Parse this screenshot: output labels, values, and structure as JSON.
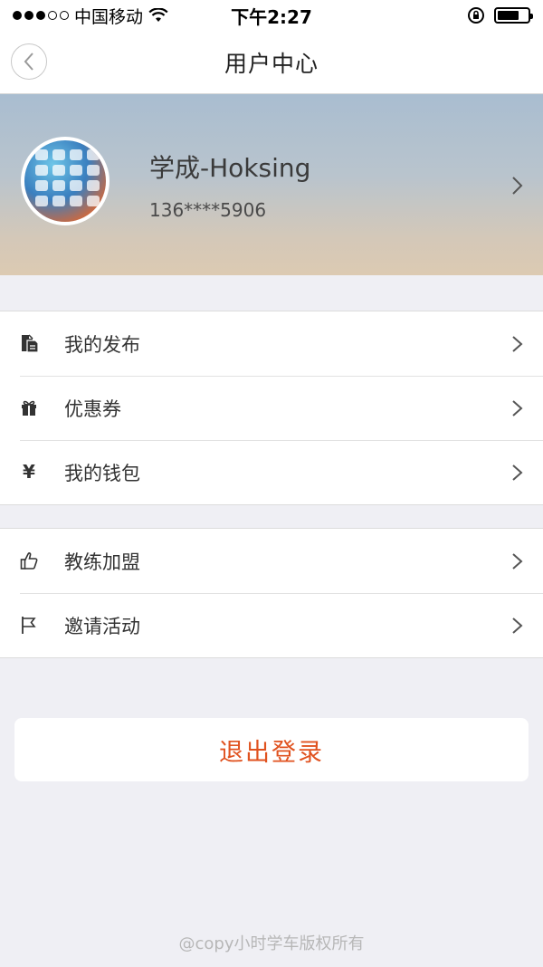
{
  "status_bar": {
    "carrier": "中国移动",
    "time": "下午2:27"
  },
  "nav": {
    "title": "用户中心",
    "back_icon": "chevron-left-icon"
  },
  "profile": {
    "name": "学成-Hoksing",
    "phone": "136****5906"
  },
  "menu_group_1": [
    {
      "label": "我的发布",
      "icon": "document-icon"
    },
    {
      "label": "优惠券",
      "icon": "gift-icon"
    },
    {
      "label": "我的钱包",
      "icon": "yen-icon",
      "glyph": "¥"
    }
  ],
  "menu_group_2": [
    {
      "label": "教练加盟",
      "icon": "thumbs-up-icon"
    },
    {
      "label": "邀请活动",
      "icon": "flag-icon"
    }
  ],
  "logout_label": "退出登录",
  "footer_text": "@copy小时学车版权所有",
  "colors": {
    "accent": "#e0521f",
    "background": "#efeff4"
  }
}
